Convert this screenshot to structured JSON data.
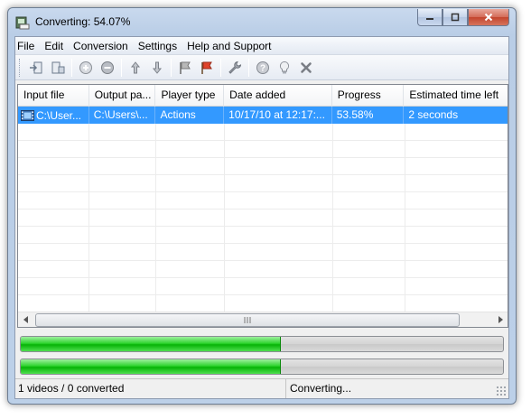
{
  "window": {
    "title": "Converting: 54.07%",
    "caption_buttons": {
      "minimize": "—",
      "maximize": "□",
      "close": "✕"
    }
  },
  "menu": [
    "File",
    "Edit",
    "Conversion",
    "Settings",
    "Help and Support"
  ],
  "toolbar": {
    "icons": [
      "import-icon",
      "export-icon",
      "add-icon",
      "remove-icon",
      "move-up-icon",
      "move-down-icon",
      "flag-gray-icon",
      "flag-red-icon",
      "wrench-icon",
      "help-icon",
      "lightbulb-icon",
      "cancel-icon"
    ]
  },
  "list": {
    "columns": [
      "Input file",
      "Output pa...",
      "Player type",
      "Date added",
      "Progress",
      "Estimated time left"
    ],
    "rows": [
      {
        "input_file": "C:\\User...",
        "output_path": "C:\\Users\\...",
        "player_type": "Actions",
        "date_added": "10/17/10 at 12:17:...",
        "progress": "53.58%",
        "time_left": "2 seconds",
        "selected": true
      }
    ]
  },
  "progress_bars": [
    {
      "name": "file-progress",
      "fraction": 0.54
    },
    {
      "name": "total-progress",
      "fraction": 0.54
    }
  ],
  "status": {
    "left": "1 videos / 0 converted",
    "right": "Converting..."
  },
  "colors": {
    "selection": "#3399ff",
    "progress_green": "#07b307",
    "title_bar": "#c9d9ee"
  }
}
